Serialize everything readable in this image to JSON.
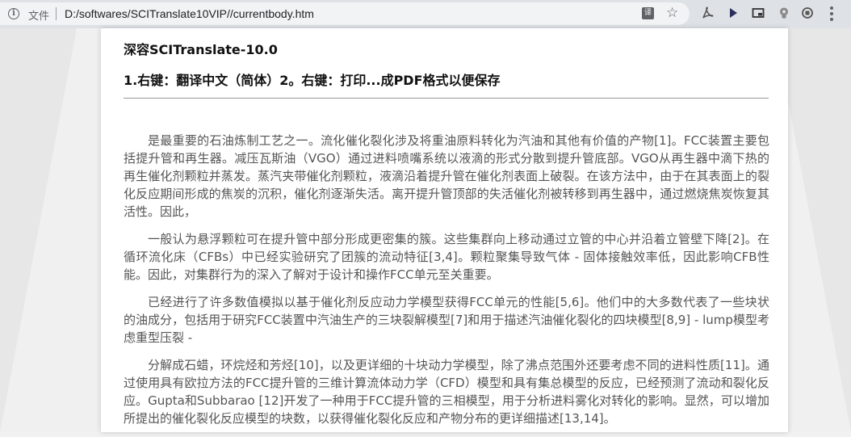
{
  "browser": {
    "file_label": "文件",
    "url": "D:/softwares/SCITranslate10VIP//currentbody.htm",
    "translate_icon": "译",
    "icons": [
      "info-icon",
      "translate-icon",
      "star-icon",
      "pdf-extension-icon",
      "play-extension-icon",
      "cast-extension-icon",
      "bulb-extension-icon",
      "ring-extension-icon",
      "menu-icon"
    ]
  },
  "document": {
    "title": "深容SCITranslate-10.0",
    "instruction": "1.右键：翻译中文（简体）2。右键：打印...成PDF格式以便保存",
    "paragraphs": [
      "是最重要的石油炼制工艺之一。流化催化裂化涉及将重油原料转化为汽油和其他有价值的产物[1]。FCC装置主要包括提升管和再生器。减压瓦斯油（VGO）通过进料喷嘴系统以液滴的形式分散到提升管底部。VGO从再生器中滴下热的再生催化剂颗粒并蒸发。蒸汽夹带催化剂颗粒，液滴沿着提升管在催化剂表面上破裂。在该方法中，由于在其表面上的裂化反应期间形成的焦炭的沉积，催化剂逐渐失活。离开提升管顶部的失活催化剂被转移到再生器中，通过燃烧焦炭恢复其活性。因此，",
      "一般认为悬浮颗粒可在提升管中部分形成更密集的簇。这些集群向上移动通过立管的中心并沿着立管壁下降[2]。在循环流化床（CFBs）中已经实验研究了团簇的流动特征[3,4]。颗粒聚集导致气体 - 固体接触效率低，因此影响CFB性能。因此，对集群行为的深入了解对于设计和操作FCC单元至关重要。",
      "已经进行了许多数值模拟以基于催化剂反应动力学模型获得FCC单元的性能[5,6]。他们中的大多数代表了一些块状的油成分，包括用于研究FCC装置中汽油生产的三块裂解模型[7]和用于描述汽油催化裂化的四块模型[8,9] - lump模型考虑重型压裂 -",
      "分解成石蜡，环烷烃和芳烃[10]，以及更详细的十块动力学模型，除了沸点范围外还要考虑不同的进料性质[11]。通过使用具有欧拉方法的FCC提升管的三维计算流体动力学（CFD）模型和具有集总模型的反应，已经预测了流动和裂化反应。Gupta和Subbarao [12]开发了一种用于FCC提升管的三相模型，用于分析进料雾化对转化的影响。显然，可以增加所提出的催化裂化反应模型的块数，以获得催化裂化反应和产物分布的更详细描述[13,14]。"
    ]
  }
}
